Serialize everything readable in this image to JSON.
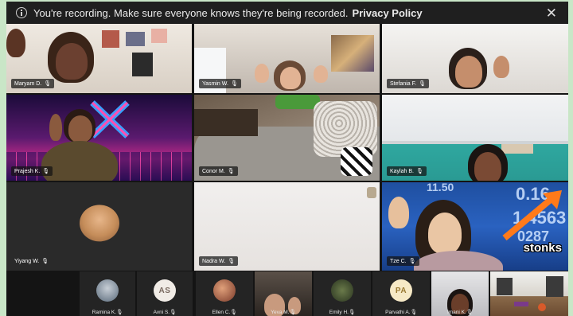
{
  "banner": {
    "message": "You're recording. Make sure everyone knows they're being recorded.",
    "policy_link": "Privacy Policy",
    "close_glyph": "✕",
    "info_icon": "info-icon"
  },
  "mic_muted_glyph": "🎙",
  "grid": [
    {
      "name": "Maryam D."
    },
    {
      "name": "Yasmin W."
    },
    {
      "name": "Stefania F."
    },
    {
      "name": "Prajesh K."
    },
    {
      "name": "Conor M."
    },
    {
      "name": "Kaylah B."
    },
    {
      "name": "Yiyang W."
    },
    {
      "name": "Nadra W."
    },
    {
      "name": "Tze C."
    }
  ],
  "stonks": {
    "caption": "stonks",
    "numbers": [
      "11.50",
      "0.16",
      "1.4563",
      "0287"
    ]
  },
  "strip": [
    {
      "name": "Ramina K.",
      "type": "photo"
    },
    {
      "name": "Avni S.",
      "type": "initials",
      "initials": "AS"
    },
    {
      "name": "Ellen C.",
      "type": "photo"
    },
    {
      "name": "Yeva M.",
      "type": "video"
    },
    {
      "name": "Emily H.",
      "type": "photo"
    },
    {
      "name": "Parvathi A.",
      "type": "initials",
      "initials": "PA"
    },
    {
      "name": "Imani K.",
      "type": "video"
    },
    {
      "name": "",
      "type": "video"
    }
  ],
  "colors": {
    "initials_bg_light": "#f1ece6",
    "initials_text_as": "#7a6a60",
    "initials_bg_pa": "#f6e9c6",
    "initials_text_pa": "#9a7a33"
  }
}
